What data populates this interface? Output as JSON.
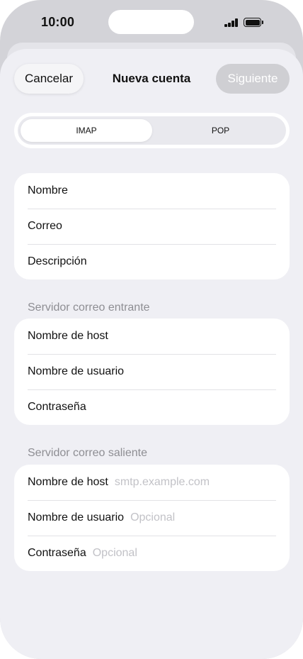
{
  "status_bar": {
    "time": "10:00"
  },
  "nav": {
    "cancel": "Cancelar",
    "title": "Nueva cuenta",
    "next": "Siguiente"
  },
  "segments": {
    "imap": "IMAP",
    "pop": "POP",
    "selected": "IMAP"
  },
  "account": {
    "name": "Nombre",
    "email": "Correo",
    "description": "Descripción"
  },
  "incoming": {
    "header": "Servidor correo entrante",
    "host": "Nombre de host",
    "username": "Nombre de usuario",
    "password": "Contraseña"
  },
  "outgoing": {
    "header": "Servidor correo saliente",
    "host": "Nombre de host",
    "host_placeholder": "smtp.example.com",
    "username": "Nombre de usuario",
    "username_placeholder": "Opcional",
    "password": "Contraseña",
    "password_placeholder": "Opcional"
  }
}
